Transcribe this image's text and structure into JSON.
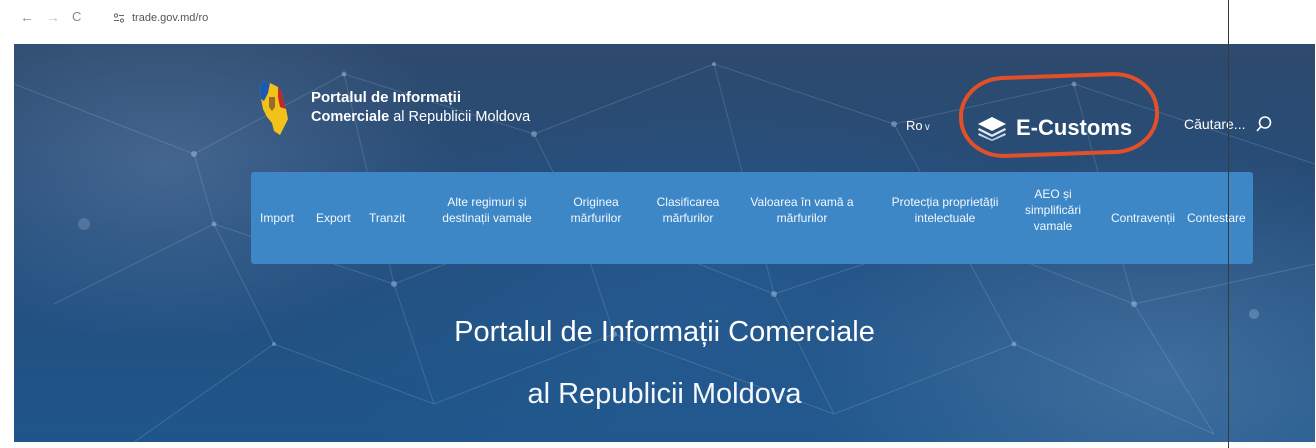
{
  "browser": {
    "back_glyph": "←",
    "forward_glyph": "→",
    "reload_glyph": "C",
    "url": "trade.gov.md/ro"
  },
  "header": {
    "brand_line1": "Portalul de Informații",
    "brand_line2_bold": "Comerciale",
    "brand_line2_rest": " al Republicii Moldova",
    "language": "Ro",
    "language_chevron": "∨",
    "ecustoms_label": "E-Customs",
    "search_placeholder": "Căutare..."
  },
  "menu": {
    "items": [
      {
        "line1": "Import",
        "line2": "",
        "line3": ""
      },
      {
        "line1": "Export",
        "line2": "",
        "line3": ""
      },
      {
        "line1": "Tranzit",
        "line2": "",
        "line3": ""
      },
      {
        "line1": "Alte regimuri și",
        "line2": "destinații vamale",
        "line3": ""
      },
      {
        "line1": "Originea",
        "line2": "mărfurilor",
        "line3": ""
      },
      {
        "line1": "Clasificarea",
        "line2": "mărfurilor",
        "line3": ""
      },
      {
        "line1": "Valoarea în vamă a",
        "line2": "mărfurilor",
        "line3": ""
      },
      {
        "line1": "Protecția proprietății",
        "line2": "intelectuale",
        "line3": ""
      },
      {
        "line1": "AEO și",
        "line2": "simplificări",
        "line3": "vamale"
      },
      {
        "line1": "Contravenții",
        "line2": "",
        "line3": ""
      },
      {
        "line1": "Contestare",
        "line2": "",
        "line3": ""
      }
    ]
  },
  "hero": {
    "title_line1": "Portalul de Informații Comerciale",
    "title_line2": "al Republicii Moldova"
  },
  "colors": {
    "menu_bg": "#3d87c7",
    "highlight_oval": "#e2502a",
    "hero_bg": "#244d7b"
  }
}
